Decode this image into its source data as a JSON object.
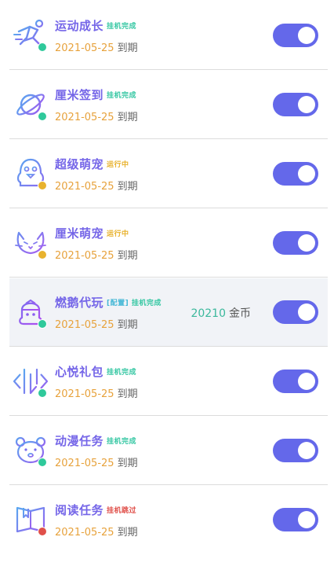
{
  "colors": {
    "accent": "#6468ea",
    "title": "#7566e8",
    "date": "#e7a23c",
    "done": "#35c7a3",
    "running": "#e8b22e",
    "skipped": "#e0504a"
  },
  "tasks": [
    {
      "title": "运动成长",
      "status": "挂机完成",
      "status_prefix": "",
      "date": "2021-05-25",
      "expire": "到期",
      "dot": "#2fc99b",
      "icon": "runner-icon",
      "enabled": true
    },
    {
      "title": "厘米签到",
      "status": "挂机完成",
      "status_prefix": "",
      "date": "2021-05-25",
      "expire": "到期",
      "dot": "#2fc99b",
      "icon": "planet-icon",
      "enabled": true
    },
    {
      "title": "超级萌宠",
      "status": "运行中",
      "status_prefix": "",
      "date": "2021-05-25",
      "expire": "到期",
      "dot": "#e8b22e",
      "icon": "penguin-icon",
      "enabled": true
    },
    {
      "title": "厘米萌宠",
      "status": "运行中",
      "status_prefix": "",
      "date": "2021-05-25",
      "expire": "到期",
      "dot": "#e8b22e",
      "icon": "cat-icon",
      "enabled": true
    },
    {
      "title": "燃鹅代玩",
      "status": "挂机完成",
      "status_prefix": "[配置]",
      "date": "2021-05-25",
      "expire": "到期",
      "dot": "#2fc99b",
      "icon": "penguin-helmet-icon",
      "enabled": true,
      "coins": "20210",
      "coins_unit": "金币"
    },
    {
      "title": "心悦礼包",
      "status": "挂机完成",
      "status_prefix": "",
      "date": "2021-05-25",
      "expire": "到期",
      "dot": "#2fc99b",
      "icon": "gift-arrows-icon",
      "enabled": true
    },
    {
      "title": "动漫任务",
      "status": "挂机完成",
      "status_prefix": "",
      "date": "2021-05-25",
      "expire": "到期",
      "dot": "#2fc99b",
      "icon": "bear-icon",
      "enabled": true
    },
    {
      "title": "阅读任务",
      "status": "挂机跳过",
      "status_prefix": "",
      "date": "2021-05-25",
      "expire": "到期",
      "dot": "#e0504a",
      "icon": "book-icon",
      "enabled": true
    }
  ]
}
